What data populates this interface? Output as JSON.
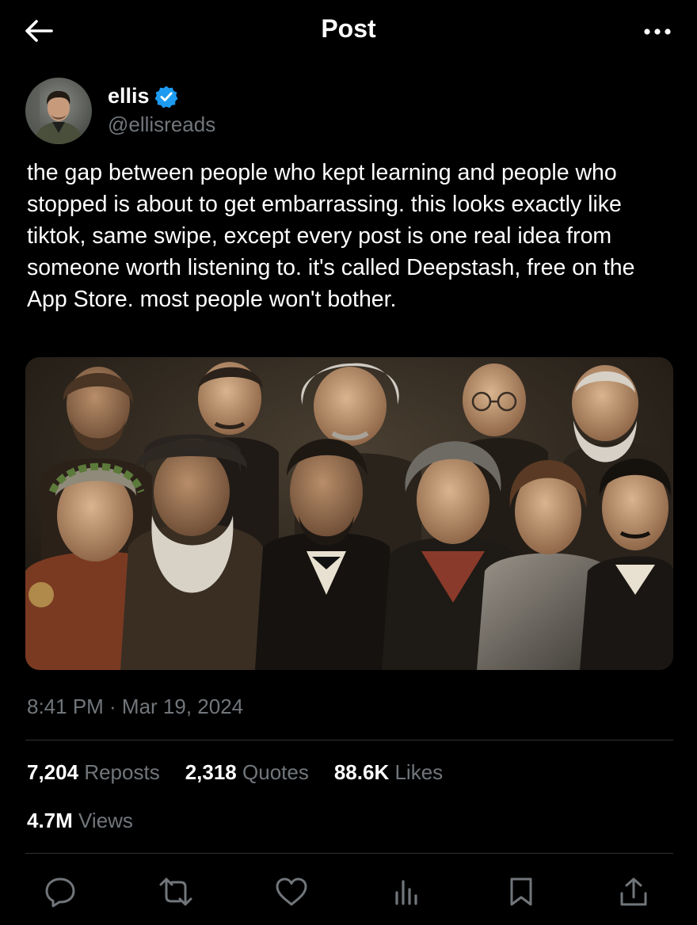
{
  "header": {
    "title": "Post",
    "back_icon": "arrow-left-icon",
    "more_icon": "more-horizontal-icon"
  },
  "author": {
    "display_name": "ellis",
    "handle": "@ellisreads",
    "verified": true,
    "verified_color": "#1d9bf0",
    "avatar_icon": "avatar-image"
  },
  "post": {
    "text": "the gap between people who kept learning and people who stopped is about to get embarrassing. this looks exactly like tiktok, same swipe, except every post is one real idea from someone worth listening to. it's called Deepstash, free on the App Store. most people won't bother.",
    "timestamp": "8:41 PM · Mar 19, 2024",
    "media_description_icon": "portrait-painting-image"
  },
  "stats": {
    "reposts": {
      "value": "7,204",
      "label": "Reposts"
    },
    "quotes": {
      "value": "2,318",
      "label": "Quotes"
    },
    "likes": {
      "value": "88.6K",
      "label": "Likes"
    },
    "views": {
      "value": "4.7M",
      "label": "Views"
    }
  },
  "actions": [
    {
      "name": "reply",
      "icon": "reply-icon"
    },
    {
      "name": "repost",
      "icon": "repost-icon"
    },
    {
      "name": "like",
      "icon": "heart-icon"
    },
    {
      "name": "views",
      "icon": "analytics-icon"
    },
    {
      "name": "bookmark",
      "icon": "bookmark-icon"
    },
    {
      "name": "share",
      "icon": "share-icon"
    }
  ],
  "colors": {
    "background": "#000000",
    "primary_text": "#ffffff",
    "secondary_text": "#71767b",
    "divider": "#2f3336",
    "icon": "#71767b"
  }
}
